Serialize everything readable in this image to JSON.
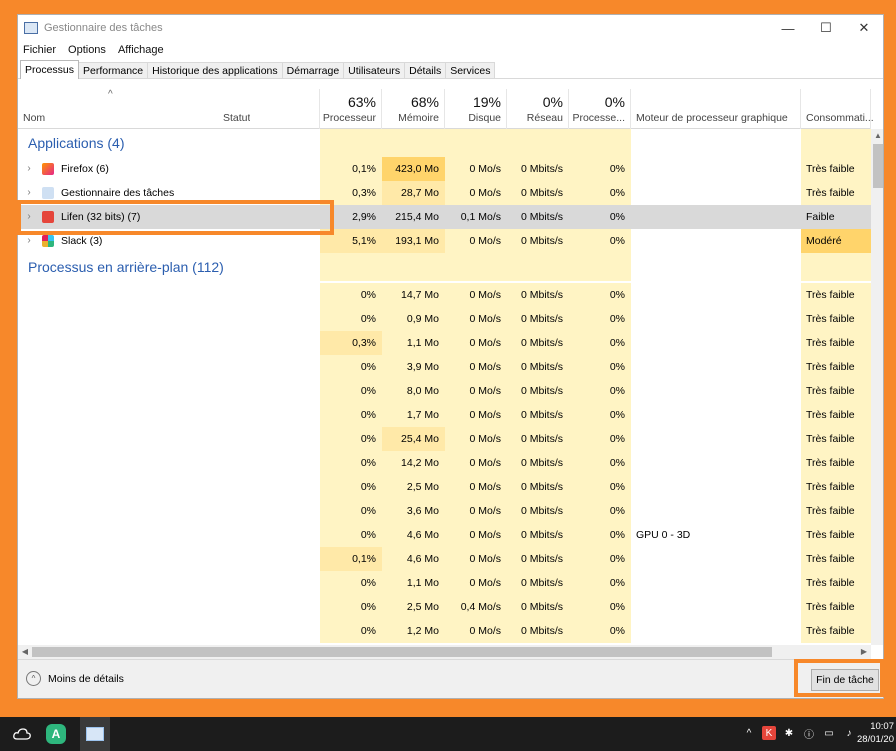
{
  "window": {
    "title": "Gestionnaire des tâches",
    "controls": {
      "minimize": "—",
      "maximize": "☐",
      "close": "✕"
    }
  },
  "menu": [
    "Fichier",
    "Options",
    "Affichage"
  ],
  "tabs": [
    "Processus",
    "Performance",
    "Historique des applications",
    "Démarrage",
    "Utilisateurs",
    "Détails",
    "Services"
  ],
  "active_tab": "Processus",
  "columns": {
    "name": "Nom",
    "status": "Statut",
    "cpu": {
      "pct": "63%",
      "label": "Processeur"
    },
    "memory": {
      "pct": "68%",
      "label": "Mémoire"
    },
    "disk": {
      "pct": "19%",
      "label": "Disque"
    },
    "network": {
      "pct": "0%",
      "label": "Réseau"
    },
    "gpu": {
      "pct": "0%",
      "label": "Processe..."
    },
    "gpu_engine": "Moteur de processeur graphique",
    "power": "Consommati..."
  },
  "groups": {
    "apps": "Applications (4)",
    "background": "Processus en arrière-plan (112)"
  },
  "apps": [
    {
      "name": "Firefox (6)",
      "icon": "firefox-icon",
      "cpu": "0,1%",
      "mem": "423,0 Mo",
      "disk": "0 Mo/s",
      "net": "0 Mbits/s",
      "gpu": "0%",
      "engine": "",
      "power": "Très faible",
      "mem_heat": "heat3",
      "cpu_heat": "heat1",
      "power_heat": "heat1"
    },
    {
      "name": "Gestionnaire des tâches",
      "icon": "task-manager-icon",
      "cpu": "0,3%",
      "mem": "28,7 Mo",
      "disk": "0 Mo/s",
      "net": "0 Mbits/s",
      "gpu": "0%",
      "engine": "",
      "power": "Très faible",
      "mem_heat": "heat2",
      "cpu_heat": "heat1",
      "power_heat": "heat1"
    },
    {
      "name": "Lifen (32 bits) (7)",
      "icon": "lifen-icon",
      "cpu": "2,9%",
      "mem": "215,4 Mo",
      "disk": "0,1 Mo/s",
      "net": "0 Mbits/s",
      "gpu": "0%",
      "engine": "",
      "power": "Faible",
      "mem_heat": "heat2",
      "cpu_heat": "heat2",
      "power_heat": "heat2",
      "selected": true
    },
    {
      "name": "Slack (3)",
      "icon": "slack-icon",
      "cpu": "5,1%",
      "mem": "193,1 Mo",
      "disk": "0 Mo/s",
      "net": "0 Mbits/s",
      "gpu": "0%",
      "engine": "",
      "power": "Modéré",
      "mem_heat": "heat2",
      "cpu_heat": "heat2",
      "power_heat": "heat3"
    }
  ],
  "background": [
    {
      "cpu": "0%",
      "mem": "14,7 Mo",
      "disk": "0 Mo/s",
      "net": "0 Mbits/s",
      "gpu": "0%",
      "engine": "",
      "power": "Très faible"
    },
    {
      "cpu": "0%",
      "mem": "0,9 Mo",
      "disk": "0 Mo/s",
      "net": "0 Mbits/s",
      "gpu": "0%",
      "engine": "",
      "power": "Très faible"
    },
    {
      "cpu": "0,3%",
      "mem": "1,1 Mo",
      "disk": "0 Mo/s",
      "net": "0 Mbits/s",
      "gpu": "0%",
      "engine": "",
      "power": "Très faible"
    },
    {
      "cpu": "0%",
      "mem": "3,9 Mo",
      "disk": "0 Mo/s",
      "net": "0 Mbits/s",
      "gpu": "0%",
      "engine": "",
      "power": "Très faible"
    },
    {
      "cpu": "0%",
      "mem": "8,0 Mo",
      "disk": "0 Mo/s",
      "net": "0 Mbits/s",
      "gpu": "0%",
      "engine": "",
      "power": "Très faible"
    },
    {
      "cpu": "0%",
      "mem": "1,7 Mo",
      "disk": "0 Mo/s",
      "net": "0 Mbits/s",
      "gpu": "0%",
      "engine": "",
      "power": "Très faible"
    },
    {
      "cpu": "0%",
      "mem": "25,4 Mo",
      "disk": "0 Mo/s",
      "net": "0 Mbits/s",
      "gpu": "0%",
      "engine": "",
      "power": "Très faible"
    },
    {
      "cpu": "0%",
      "mem": "14,2 Mo",
      "disk": "0 Mo/s",
      "net": "0 Mbits/s",
      "gpu": "0%",
      "engine": "",
      "power": "Très faible"
    },
    {
      "cpu": "0%",
      "mem": "2,5 Mo",
      "disk": "0 Mo/s",
      "net": "0 Mbits/s",
      "gpu": "0%",
      "engine": "",
      "power": "Très faible"
    },
    {
      "cpu": "0%",
      "mem": "3,6 Mo",
      "disk": "0 Mo/s",
      "net": "0 Mbits/s",
      "gpu": "0%",
      "engine": "",
      "power": "Très faible"
    },
    {
      "cpu": "0%",
      "mem": "4,6 Mo",
      "disk": "0 Mo/s",
      "net": "0 Mbits/s",
      "gpu": "0%",
      "engine": "GPU 0 - 3D",
      "power": "Très faible"
    },
    {
      "cpu": "0,1%",
      "mem": "4,6 Mo",
      "disk": "0 Mo/s",
      "net": "0 Mbits/s",
      "gpu": "0%",
      "engine": "",
      "power": "Très faible"
    },
    {
      "cpu": "0%",
      "mem": "1,1 Mo",
      "disk": "0 Mo/s",
      "net": "0 Mbits/s",
      "gpu": "0%",
      "engine": "",
      "power": "Très faible"
    },
    {
      "cpu": "0%",
      "mem": "2,5 Mo",
      "disk": "0,4 Mo/s",
      "net": "0 Mbits/s",
      "gpu": "0%",
      "engine": "",
      "power": "Très faible"
    },
    {
      "cpu": "0%",
      "mem": "1,2 Mo",
      "disk": "0 Mo/s",
      "net": "0 Mbits/s",
      "gpu": "0%",
      "engine": "",
      "power": "Très faible"
    }
  ],
  "footer": {
    "less_details": "Moins de détails",
    "end_task": "Fin de tâche"
  },
  "taskbar": {
    "time": "10:07",
    "date": "28/01/20"
  },
  "colors": {
    "accent": "#f7882a",
    "group_title": "#2b5eaf",
    "heat_light": "#fff4c4",
    "heat_medium": "#ffe9a8",
    "heat_strong": "#ffd46b"
  }
}
